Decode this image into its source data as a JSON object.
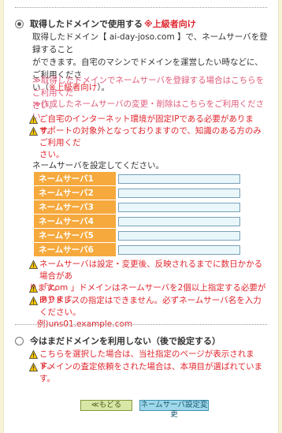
{
  "option1": {
    "title": "取得したドメインで使用する",
    "badge": "※上級者向け",
    "desc_line1": "取得したドメイン【 ai-day-joso.com 】で、ネームサーバを登録すること",
    "desc_line2": "ができます。自宅のマシンでドメインを運営したい時などに、ご利用くださ",
    "desc_line3_a": "い（",
    "desc_line3_red": "※上級者向け",
    "desc_line3_b": "）。",
    "link1_line1": "≫取得したドメインでネームサーバを登録する場合はこちらをご利用くだ",
    "link1_line2": "さい。",
    "link2": "≫作成したネームサーバの変更・削除はこちらをご利用ください。",
    "warn1": "ご自宅のインターネット環境が固定IPである必要があります。",
    "warn2_line1": "サポートの対象外となっておりますので、知識のある方のみご利用くだ",
    "warn2_line2": "さい。",
    "form_prompt": "ネームサーバを設定してください。",
    "ns_rows": [
      {
        "label": "ネームサーバ1",
        "value": ""
      },
      {
        "label": "ネームサーバ2",
        "value": ""
      },
      {
        "label": "ネームサーバ3",
        "value": ""
      },
      {
        "label": "ネームサーバ4",
        "value": ""
      },
      {
        "label": "ネームサーバ5",
        "value": ""
      },
      {
        "label": "ネームサーバ6",
        "value": ""
      }
    ],
    "note1_line1": "ネームサーバは設定・変更後、反映されるまでに数日かかる場合があ",
    "note1_line2": "ります。",
    "note2": "「.com 」ドメインはネームサーバを2個以上指定する必要があります。",
    "note3_line1": "IPアドレスの指定はできません。必ずネームサーバ名を入力ください。",
    "note3_line2": "例)uns01.example.com"
  },
  "option2": {
    "title": "今はまだドメインを利用しない（後で設定する）",
    "note1": "こちらを選択した場合は、当社指定のページが表示されます。",
    "note2": "ドメインの査定依頼をされた場合は、本項目が選ばれています。"
  },
  "buttons": {
    "back": "≪もどる",
    "set": "ネームサーバ設定変更"
  },
  "colors": {
    "accent_red": "#e0262e",
    "pink_text": "#e05a7a",
    "label_orange": "#f6a93d",
    "warn_yellow": "#f5c400"
  }
}
